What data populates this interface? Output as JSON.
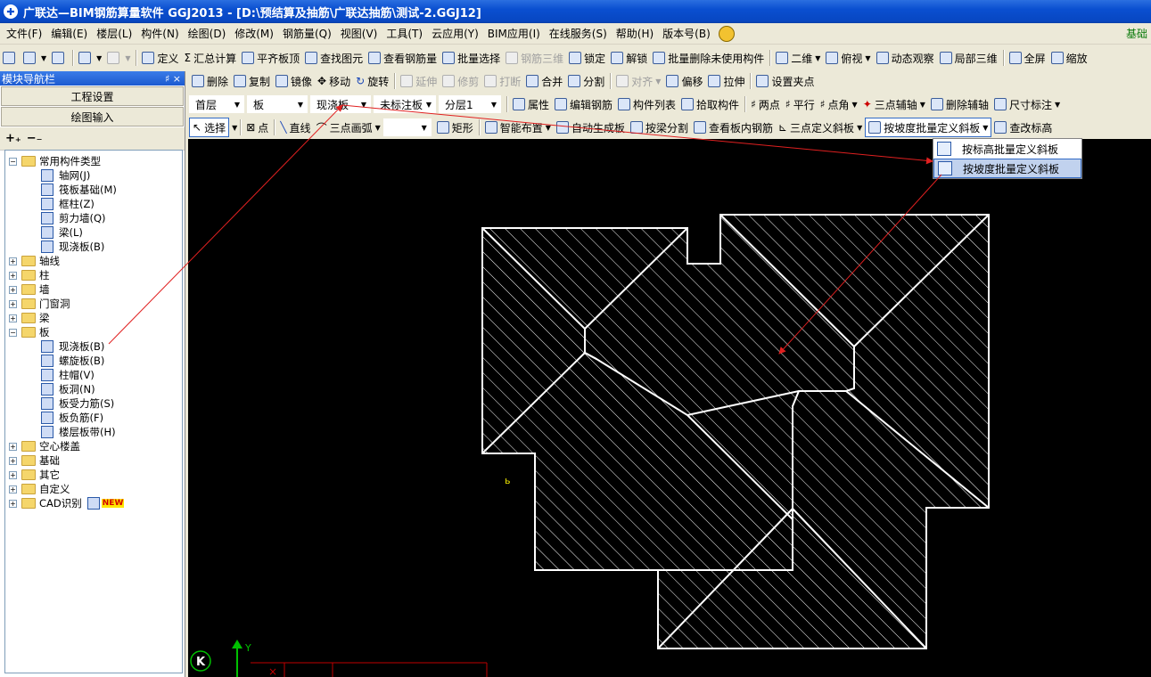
{
  "window": {
    "title": "广联达—BIM钢筋算量软件 GGJ2013 - [D:\\预结算及抽筋\\广联达抽筋\\测试-2.GGJ12]",
    "icon": "app-logo-icon"
  },
  "menu": {
    "items": [
      "文件(F)",
      "编辑(E)",
      "楼层(L)",
      "构件(N)",
      "绘图(D)",
      "修改(M)",
      "钢筋量(Q)",
      "视图(V)",
      "工具(T)",
      "云应用(Y)",
      "BIM应用(I)",
      "在线服务(S)",
      "帮助(H)",
      "版本号(B)"
    ],
    "right_tag": "基础"
  },
  "toolbar1": {
    "define": "定义",
    "sum_calc": "汇总计算",
    "flush_top": "平齐板顶",
    "find_element": "查找图元",
    "view_rebar": "查看钢筋量",
    "batch_select": "批量选择",
    "rebar_3d": "钢筋三维",
    "lock": "锁定",
    "unlock": "解锁",
    "batch_delete_unused": "批量删除未使用构件",
    "view_mode": "二维",
    "top_view": "俯视",
    "dynamic_observe": "动态观察",
    "local_3d": "局部三维",
    "fullscreen": "全屏",
    "zoom": "缩放"
  },
  "toolbar2": {
    "delete": "删除",
    "copy": "复制",
    "mirror": "镜像",
    "move": "移动",
    "rotate": "旋转",
    "extend": "延伸",
    "trim": "修剪",
    "break": "打断",
    "merge": "合并",
    "split": "分割",
    "align": "对齐",
    "offset": "偏移",
    "stretch": "拉伸",
    "set_grip": "设置夹点"
  },
  "toolbar3": {
    "floor": "首层",
    "category": "板",
    "component_type": "现浇板",
    "component": "未标注板",
    "layer": "分层1",
    "properties": "属性",
    "edit_rebar": "编辑钢筋",
    "component_list": "构件列表",
    "pick_component": "拾取构件",
    "two_points": "两点",
    "parallel": "平行",
    "point_angle": "点角",
    "three_point_axis": "三点辅轴",
    "delete_axis": "删除辅轴",
    "dimension": "尺寸标注"
  },
  "toolbar4": {
    "select": "选择",
    "point": "点",
    "line": "直线",
    "arc": "三点画弧",
    "rect": "矩形",
    "smart_layout": "智能布置",
    "auto_generate": "自动生成板",
    "split_by_beam": "按梁分割",
    "view_slab_rebar": "查看板内钢筋",
    "three_point_slope": "三点定义斜板",
    "batch_slope_by_grade": "按坡度批量定义斜板",
    "view_elevation": "查改标高"
  },
  "dropdown_menu": {
    "items": [
      "按标高批量定义斜板",
      "按坡度批量定义斜板"
    ],
    "highlighted_index": 1
  },
  "nav": {
    "title": "模块导航栏",
    "controls": "♯ ×",
    "btn_project": "工程设置",
    "btn_draw": "绘图输入",
    "tree": [
      {
        "label": "常用构件类型",
        "level": 0,
        "expanded": true,
        "folder": true
      },
      {
        "label": "轴网(J)",
        "level": 1,
        "icon": "grid-icon"
      },
      {
        "label": "筏板基础(M)",
        "level": 1,
        "icon": "raft-foundation-icon"
      },
      {
        "label": "框柱(Z)",
        "level": 1,
        "icon": "frame-column-icon"
      },
      {
        "label": "剪力墙(Q)",
        "level": 1,
        "icon": "shear-wall-icon"
      },
      {
        "label": "梁(L)",
        "level": 1,
        "icon": "beam-icon"
      },
      {
        "label": "现浇板(B)",
        "level": 1,
        "icon": "cast-slab-icon"
      },
      {
        "label": "轴线",
        "level": 0,
        "expanded": false,
        "folder": true
      },
      {
        "label": "柱",
        "level": 0,
        "expanded": false,
        "folder": true
      },
      {
        "label": "墙",
        "level": 0,
        "expanded": false,
        "folder": true
      },
      {
        "label": "门窗洞",
        "level": 0,
        "expanded": false,
        "folder": true
      },
      {
        "label": "梁",
        "level": 0,
        "expanded": false,
        "folder": true
      },
      {
        "label": "板",
        "level": 0,
        "expanded": true,
        "folder": true
      },
      {
        "label": "现浇板(B)",
        "level": 1,
        "icon": "cast-slab-icon"
      },
      {
        "label": "螺旋板(B)",
        "level": 1,
        "icon": "spiral-slab-icon"
      },
      {
        "label": "柱帽(V)",
        "level": 1,
        "icon": "column-cap-icon"
      },
      {
        "label": "板洞(N)",
        "level": 1,
        "icon": "slab-hole-icon"
      },
      {
        "label": "板受力筋(S)",
        "level": 1,
        "icon": "slab-rebar-icon"
      },
      {
        "label": "板负筋(F)",
        "level": 1,
        "icon": "negative-rebar-icon"
      },
      {
        "label": "楼层板带(H)",
        "level": 1,
        "icon": "slab-strip-icon"
      },
      {
        "label": "空心楼盖",
        "level": 0,
        "expanded": false,
        "folder": true
      },
      {
        "label": "基础",
        "level": 0,
        "expanded": false,
        "folder": true
      },
      {
        "label": "其它",
        "level": 0,
        "expanded": false,
        "folder": true
      },
      {
        "label": "自定义",
        "level": 0,
        "expanded": false,
        "folder": true
      },
      {
        "label": "CAD识别",
        "level": 0,
        "expanded": false,
        "folder": true,
        "new": "NEW"
      }
    ]
  },
  "canvas": {
    "background": "#000000",
    "ucs_y_label": "Y",
    "ucs_k_label": "K"
  },
  "colors": {
    "annotation_arrow": "#e02020",
    "slab_line": "#ffffff",
    "ucs_axis": "#00c000"
  }
}
